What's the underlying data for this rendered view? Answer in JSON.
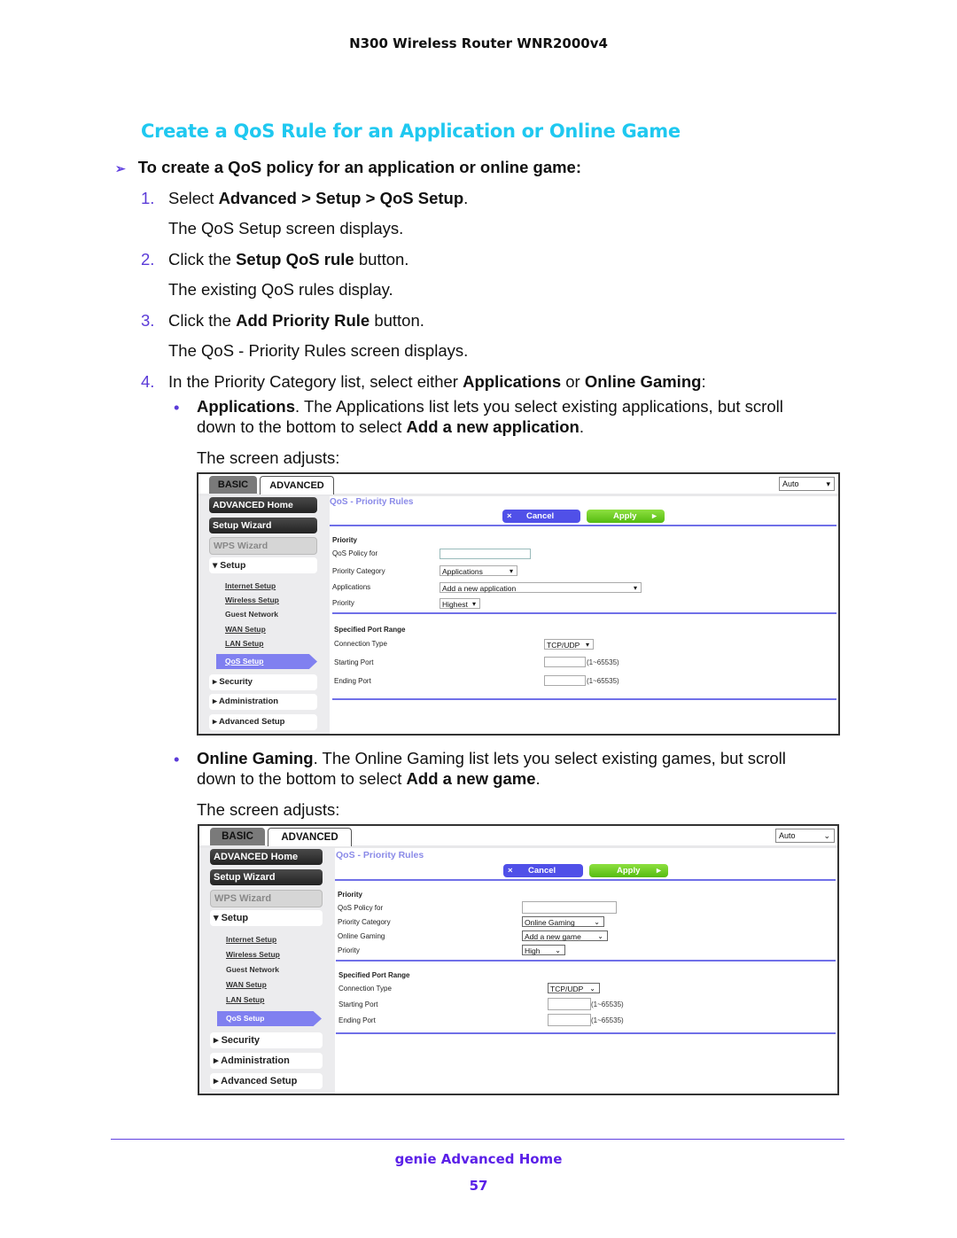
{
  "header": {
    "title": "N300 Wireless Router WNR2000v4"
  },
  "section_title": "Create a QoS Rule for an Application or Online Game",
  "procedure": {
    "arrow_icon": "➢",
    "title": "To create a QoS policy for an application or online game:"
  },
  "steps": [
    {
      "num": "1.",
      "pre": "Select ",
      "b1": "Advanced",
      "mid1": " > ",
      "b2": "Setup",
      "mid2": " > ",
      "b3": "QoS Setup",
      "post": ".",
      "result": "The QoS Setup screen displays."
    },
    {
      "num": "2.",
      "pre": "Click the ",
      "b1": "Setup QoS rule",
      "post": " button.",
      "result": "The existing QoS rules display."
    },
    {
      "num": "3.",
      "pre": "Click the ",
      "b1": "Add Priority Rule",
      "post": " button.",
      "result": "The QoS - Priority Rules screen displays."
    },
    {
      "num": "4.",
      "pre": "In the Priority Category list, select either ",
      "b1": "Applications",
      "mid1": " or ",
      "b2": "Online Gaming",
      "post": ":"
    }
  ],
  "bullets": [
    {
      "icon": "•",
      "b1": "Applications",
      "line1": ". The Applications list lets you select existing applications, but scroll",
      "line2_pre": "down to the bottom to select ",
      "b2": "Add a new application",
      "line2_post": ".",
      "after": "The screen adjusts:"
    },
    {
      "icon": "•",
      "b1": "Online Gaming",
      "line1": ". The Online Gaming list lets you select existing games, but scroll",
      "line2_pre": "down to the bottom to select ",
      "b2": "Add a new game",
      "line2_post": ".",
      "after": "The screen adjusts:"
    }
  ],
  "screens": [
    {
      "tabs": {
        "basic": "BASIC",
        "advanced": "ADVANCED"
      },
      "auto_select": "Auto",
      "sidebar": {
        "advanced_home": "ADVANCED Home",
        "setup_wizard": "Setup Wizard",
        "wps_wizard": "WPS Wizard",
        "setup": "▾ Setup",
        "sub": [
          "Internet Setup",
          "Wireless Setup",
          "Guest Network",
          "WAN Setup",
          "LAN Setup"
        ],
        "qos_setup": "QoS Setup",
        "security": "▸ Security",
        "administration": "▸ Administration",
        "advanced_setup": "▸ Advanced Setup"
      },
      "page_title": "QoS - Priority Rules",
      "cancel": "Cancel",
      "cancel_icon": "×",
      "apply": "Apply",
      "apply_icon": "▸",
      "priority_heading": "Priority",
      "labels": {
        "policy_for": "QoS Policy for",
        "category": "Priority Category",
        "list": "Applications",
        "priority": "Priority"
      },
      "values": {
        "policy_for": "",
        "category": "Applications",
        "list": "Add a new application",
        "priority": "Highest"
      },
      "port_heading": "Specified Port Range",
      "port_labels": {
        "conn": "Connection Type",
        "start": "Starting Port",
        "end": "Ending Port"
      },
      "port_values": {
        "conn": "TCP/UDP",
        "start": "",
        "end": "",
        "range": "(1~65535)"
      },
      "chevron": "▾"
    },
    {
      "tabs": {
        "basic": "BASIC",
        "advanced": "ADVANCED"
      },
      "auto_select": "Auto",
      "sidebar": {
        "advanced_home": "ADVANCED Home",
        "setup_wizard": "Setup Wizard",
        "wps_wizard": "WPS Wizard",
        "setup": "▾ Setup",
        "sub": [
          "Internet Setup",
          "Wireless Setup",
          "Guest Network",
          "WAN Setup",
          "LAN Setup"
        ],
        "qos_setup": "QoS Setup",
        "security": "▸ Security",
        "administration": "▸ Administration",
        "advanced_setup": "▸ Advanced Setup"
      },
      "page_title": "QoS - Priority Rules",
      "cancel": "Cancel",
      "cancel_icon": "×",
      "apply": "Apply",
      "apply_icon": "▸",
      "priority_heading": "Priority",
      "labels": {
        "policy_for": "QoS Policy for",
        "category": "Priority Category",
        "list": "Online Gaming",
        "priority": "Priority"
      },
      "values": {
        "policy_for": "",
        "category": "Online Gaming",
        "list": "Add a new game",
        "priority": "High"
      },
      "port_heading": "Specified Port Range",
      "port_labels": {
        "conn": "Connection Type",
        "start": "Starting Port",
        "end": "Ending Port"
      },
      "port_values": {
        "conn": "TCP/UDP",
        "start": "",
        "end": "",
        "range": "(1~65535)"
      },
      "chevron": "⌄"
    }
  ],
  "footer": {
    "section": "genie Advanced Home",
    "page": "57"
  }
}
